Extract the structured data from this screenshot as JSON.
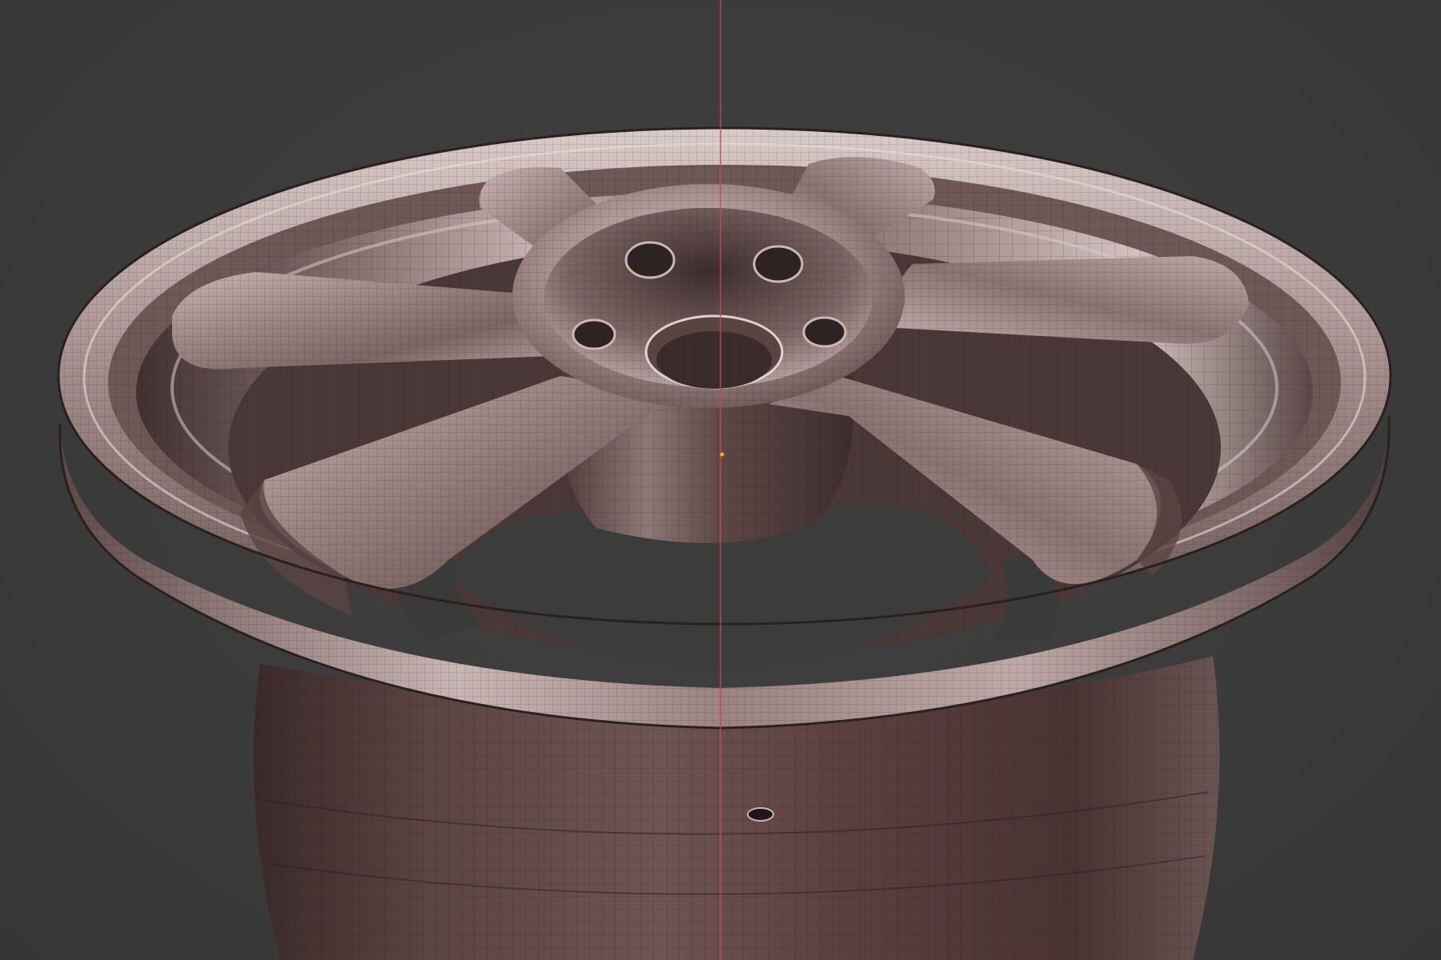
{
  "viewport": {
    "background": "#3d3d3d",
    "axis_line_color": "#d0454e",
    "material_color": "#8a7472",
    "wire_color": "#2a2222",
    "origin_color": "#f0b020"
  },
  "model": {
    "object": "car-wheel-rim",
    "spoke_count": 6,
    "lug_hole_count": 4,
    "shading": "solid-with-wireframe-overlay"
  }
}
